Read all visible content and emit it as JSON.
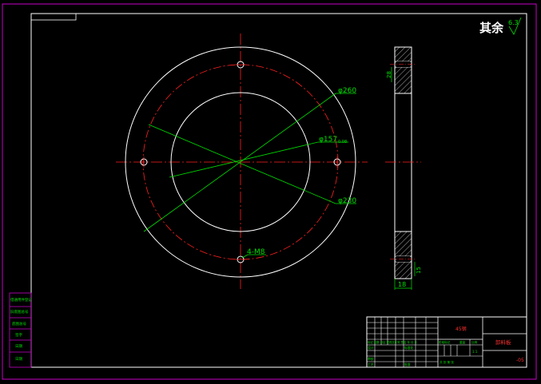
{
  "drawing": {
    "roughness_note": "其余",
    "roughness_value": "6.3",
    "dimensions": {
      "outer_diameter": "φ260",
      "bore_diameter": "φ157",
      "bore_tolerance": "0.08",
      "bolt_circle_diameter": "φ230",
      "holes": "4-M8",
      "width": "18",
      "hole_depth_top": "28",
      "hole_depth_bottom": "15"
    }
  },
  "title_block": {
    "material": "45钢",
    "part_name": "卸料板",
    "drawing_no": "-05",
    "scale": "1:1",
    "change_row": "标记 处数 分区 更改文件号 签名 年 月 日",
    "cells": {
      "designer": "设计",
      "standardize": "标准化",
      "reviewer": "审核",
      "process": "工艺",
      "approve": "批准",
      "stage_mark": "阶段标记",
      "weight": "重量",
      "ratio": "比例",
      "sheets": "共 张 第 张"
    }
  },
  "side_strip": {
    "cells": [
      "借通用件登记",
      "旧底图总号",
      "底图总号",
      "签字",
      "日期",
      "日期"
    ]
  },
  "colors": {
    "frame": "#c800c8",
    "outline": "#ffffff",
    "centerline": "#ff2020",
    "dimension": "#00e000",
    "hatch": "#d8d8d8"
  }
}
